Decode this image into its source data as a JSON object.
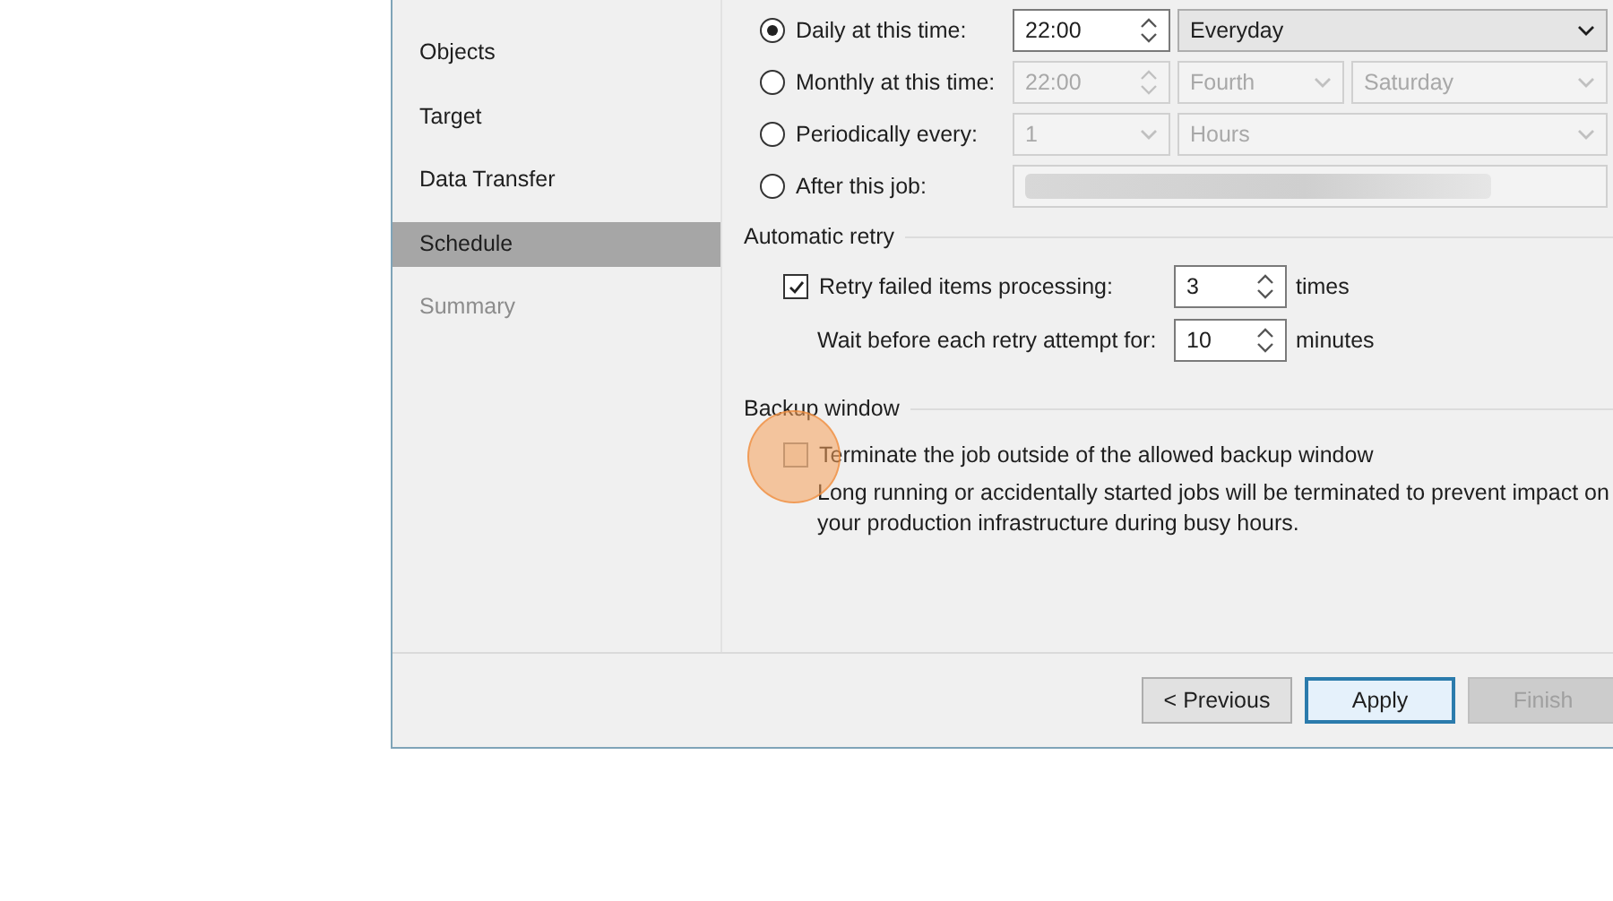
{
  "sidebar": {
    "items": [
      {
        "label": "Objects",
        "selected": false,
        "disabled": false
      },
      {
        "label": "Target",
        "selected": false,
        "disabled": false
      },
      {
        "label": "Data Transfer",
        "selected": false,
        "disabled": false
      },
      {
        "label": "Schedule",
        "selected": true,
        "disabled": false
      },
      {
        "label": "Summary",
        "selected": false,
        "disabled": true
      }
    ]
  },
  "schedule": {
    "options": [
      {
        "label": "Daily at this time:",
        "selected": true,
        "fields": [
          {
            "kind": "spin",
            "value": "22:00"
          },
          {
            "kind": "select",
            "value": "Everyday"
          }
        ]
      },
      {
        "label": "Monthly at this time:",
        "selected": false,
        "fields": [
          {
            "kind": "spin",
            "value": "22:00"
          },
          {
            "kind": "select",
            "value": "Fourth"
          },
          {
            "kind": "select",
            "value": "Saturday"
          }
        ]
      },
      {
        "label": "Periodically every:",
        "selected": false,
        "fields": [
          {
            "kind": "select",
            "value": "1"
          },
          {
            "kind": "select",
            "value": "Hours"
          }
        ]
      },
      {
        "label": "After this job:",
        "selected": false,
        "fields": [
          {
            "kind": "blurred"
          }
        ]
      }
    ]
  },
  "automatic_retry": {
    "title": "Automatic retry",
    "checked": true,
    "label": "Retry failed items processing:",
    "count": "3",
    "count_unit": "times",
    "wait_label": "Wait before each retry attempt for:",
    "wait_value": "10",
    "wait_unit": "minutes"
  },
  "backup_window": {
    "title": "Backup window",
    "checked": false,
    "highlighted": true,
    "label": "Terminate the job outside of the allowed backup window",
    "description": "Long running or accidentally started jobs will be terminated to prevent impact on your production infrastructure during busy hours."
  },
  "buttons": [
    {
      "label": "< Previous",
      "kind": "normal",
      "disabled": false
    },
    {
      "label": "Apply",
      "kind": "default",
      "disabled": false
    },
    {
      "label": "Finish",
      "kind": "normal",
      "disabled": true
    }
  ]
}
